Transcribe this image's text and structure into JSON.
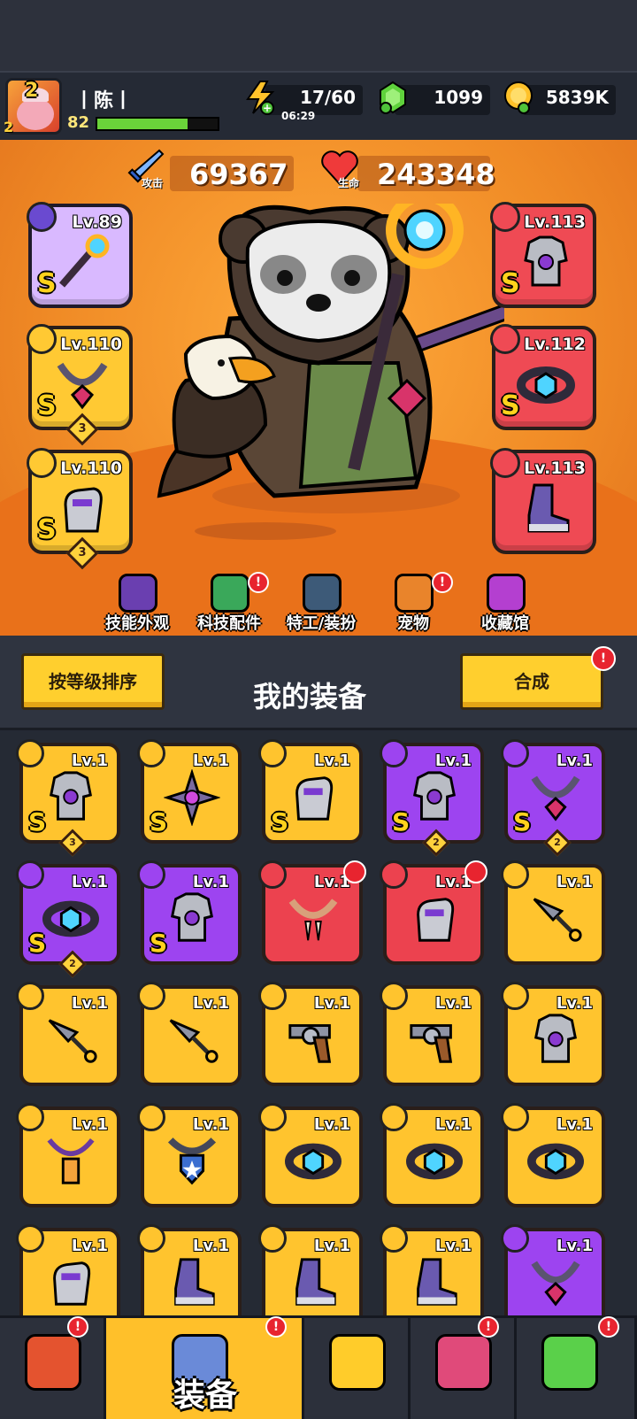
{
  "player": {
    "name": "丨陈丨",
    "level": "82",
    "vip_level": "2",
    "rank": "2",
    "xp_fraction": 0.75
  },
  "resources": {
    "energy": "17/60",
    "energy_timer": "06:29",
    "gems": "1099",
    "coins": "5839K"
  },
  "stats": {
    "attack_label": "攻击",
    "attack_value": "69367",
    "hp_label": "生命",
    "hp_value": "243348"
  },
  "equipped": {
    "left": [
      {
        "level": "Lv.89",
        "grade": "S",
        "stars": "",
        "slot": "weapon",
        "color": "violet",
        "icon": "staff-icon"
      },
      {
        "level": "Lv.110",
        "grade": "S",
        "stars": "3",
        "slot": "necklace",
        "color": "gold",
        "icon": "necklace-icon"
      },
      {
        "level": "Lv.110",
        "grade": "S",
        "stars": "3",
        "slot": "gloves",
        "color": "gold",
        "icon": "gauntlet-icon"
      }
    ],
    "right": [
      {
        "level": "Lv.113",
        "grade": "S",
        "stars": "",
        "slot": "armor",
        "color": "red",
        "icon": "armor-icon"
      },
      {
        "level": "Lv.112",
        "grade": "S",
        "stars": "",
        "slot": "belt",
        "color": "red",
        "icon": "belt-icon"
      },
      {
        "level": "Lv.113",
        "grade": "",
        "stars": "",
        "slot": "boots",
        "color": "red",
        "icon": "boots-icon"
      }
    ]
  },
  "feature_nav": [
    {
      "label": "技能外观",
      "badge": false,
      "color": "#6a3fb0"
    },
    {
      "label": "科技配件",
      "badge": true,
      "color": "#3aa85a"
    },
    {
      "label": "特工/装扮",
      "badge": false,
      "color": "#3d5a78"
    },
    {
      "label": "宠物",
      "badge": true,
      "color": "#e9842b"
    },
    {
      "label": "收藏馆",
      "badge": false,
      "color": "#b43fd0"
    }
  ],
  "equipment_panel": {
    "sort_button": "按等级排序",
    "title": "我的装备",
    "merge_button": "合成",
    "merge_badge": "!"
  },
  "inventory": [
    {
      "level": "Lv.1",
      "color": "gold",
      "grade": "S",
      "stars": "3",
      "icon": "armor-icon",
      "new": false
    },
    {
      "level": "Lv.1",
      "color": "gold",
      "grade": "S",
      "stars": "",
      "icon": "shuriken-icon",
      "new": false
    },
    {
      "level": "Lv.1",
      "color": "gold",
      "grade": "S",
      "stars": "",
      "icon": "gauntlet-icon",
      "new": false
    },
    {
      "level": "Lv.1",
      "color": "purple",
      "grade": "S",
      "stars": "2",
      "icon": "armor-icon",
      "new": false
    },
    {
      "level": "Lv.1",
      "color": "purple",
      "grade": "S",
      "stars": "2",
      "icon": "necklace-icon",
      "new": false
    },
    {
      "level": "Lv.1",
      "color": "purple",
      "grade": "S",
      "stars": "2",
      "icon": "belt-icon",
      "new": false
    },
    {
      "level": "Lv.1",
      "color": "purple",
      "grade": "S",
      "stars": "",
      "icon": "armor-icon",
      "new": false
    },
    {
      "level": "Lv.1",
      "color": "red",
      "grade": "",
      "stars": "",
      "icon": "fang-necklace-icon",
      "new": true
    },
    {
      "level": "Lv.1",
      "color": "red",
      "grade": "",
      "stars": "",
      "icon": "gauntlet-icon",
      "new": true
    },
    {
      "level": "Lv.1",
      "color": "gold",
      "grade": "",
      "stars": "",
      "icon": "kunai-icon",
      "new": false
    },
    {
      "level": "Lv.1",
      "color": "gold",
      "grade": "",
      "stars": "",
      "icon": "kunai-icon",
      "new": false
    },
    {
      "level": "Lv.1",
      "color": "gold",
      "grade": "",
      "stars": "",
      "icon": "kunai-icon",
      "new": false
    },
    {
      "level": "Lv.1",
      "color": "gold",
      "grade": "",
      "stars": "",
      "icon": "revolver-icon",
      "new": false
    },
    {
      "level": "Lv.1",
      "color": "gold",
      "grade": "",
      "stars": "",
      "icon": "revolver-icon",
      "new": false
    },
    {
      "level": "Lv.1",
      "color": "gold",
      "grade": "",
      "stars": "",
      "icon": "armor-icon",
      "new": false
    },
    {
      "level": "Lv.1",
      "color": "gold",
      "grade": "",
      "stars": "",
      "icon": "lantern-necklace-icon",
      "new": false
    },
    {
      "level": "Lv.1",
      "color": "gold",
      "grade": "",
      "stars": "",
      "icon": "badge-necklace-icon",
      "new": false
    },
    {
      "level": "Lv.1",
      "color": "gold",
      "grade": "",
      "stars": "",
      "icon": "belt-icon",
      "new": false
    },
    {
      "level": "Lv.1",
      "color": "gold",
      "grade": "",
      "stars": "",
      "icon": "belt-icon",
      "new": false
    },
    {
      "level": "Lv.1",
      "color": "gold",
      "grade": "",
      "stars": "",
      "icon": "belt-icon",
      "new": false
    },
    {
      "level": "Lv.1",
      "color": "gold",
      "grade": "",
      "stars": "",
      "icon": "gauntlet-icon",
      "new": false
    },
    {
      "level": "Lv.1",
      "color": "gold",
      "grade": "",
      "stars": "",
      "icon": "boots-icon",
      "new": false
    },
    {
      "level": "Lv.1",
      "color": "gold",
      "grade": "",
      "stars": "",
      "icon": "boots-icon",
      "new": false
    },
    {
      "level": "Lv.1",
      "color": "gold",
      "grade": "",
      "stars": "",
      "icon": "boots-icon",
      "new": false
    },
    {
      "level": "Lv.1",
      "color": "purple",
      "grade": "",
      "stars": "",
      "icon": "necklace-icon",
      "new": false
    }
  ],
  "bottom_tabs": [
    {
      "name": "shop",
      "label": "",
      "badge": true,
      "active": false
    },
    {
      "name": "equipment",
      "label": "装备",
      "badge": true,
      "active": true
    },
    {
      "name": "battle",
      "label": "",
      "badge": false,
      "active": false
    },
    {
      "name": "gacha",
      "label": "",
      "badge": true,
      "active": false
    },
    {
      "name": "evolve",
      "label": "",
      "badge": true,
      "active": false
    }
  ],
  "colors": {
    "gold": "#ffc42e",
    "purple": "#9d44f0",
    "red": "#ec424f",
    "stage": "#f08b26"
  }
}
